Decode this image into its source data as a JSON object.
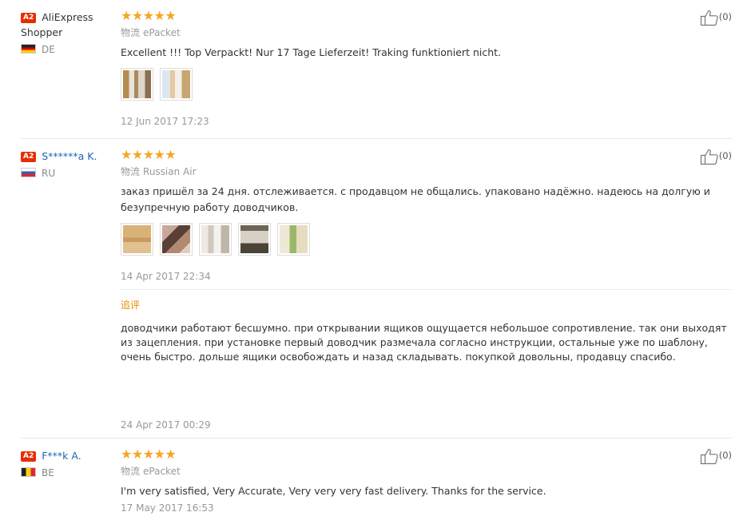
{
  "reviews": [
    {
      "badge": "A2",
      "user_name": "AliExpress Shopper",
      "country": "DE",
      "stars": "★★★★★",
      "shipping_label": "物流",
      "shipping_method": "ePacket",
      "text": "Excellent !!! Top Verpackt! Nur 17 Tage Lieferzeit! Traking funktioniert nicht.",
      "date": "12 Jun 2017 17:23",
      "helpful_count": "(0)"
    },
    {
      "badge": "A2",
      "user_name": "S******a K.",
      "country": "RU",
      "stars": "★★★★★",
      "shipping_label": "物流",
      "shipping_method": "Russian Air",
      "text": "заказ пришёл за 24 дня. отслеживается. с продавцом не общались. упаковано надёжно. надеюсь на долгую и безупречную работу доводчиков.",
      "date": "14 Apr 2017 22:34",
      "helpful_count": "(0)",
      "append": {
        "label": "追评",
        "text": "доводчики работают бесшумно. при открывании ящиков ощущается небольшое сопротивление. так они выходят из зацепления. при установке первый доводчик размечала согласно инструкции, остальные уже по шаблону, очень быстро. дольше ящики освобождать и назад складывать. покупкой довольны, продавцу спасибо.",
        "date": "24 Apr 2017 00:29"
      }
    },
    {
      "badge": "A2",
      "user_name": "F***k A.",
      "country": "BE",
      "stars": "★★★★★",
      "shipping_label": "物流",
      "shipping_method": "ePacket",
      "text": "I'm very satisfied, Very Accurate, Very very very fast delivery. Thanks for the service.",
      "date": "17 May 2017 16:53",
      "helpful_count": "(0)"
    }
  ],
  "colors": {
    "badge": "#e62e04",
    "star": "#f5a623",
    "link_name": "#1a66b3",
    "append_label": "#e88c00"
  },
  "icons": [
    "thumbs-up-icon",
    "flag-de-icon",
    "flag-ru-icon",
    "flag-be-icon"
  ]
}
